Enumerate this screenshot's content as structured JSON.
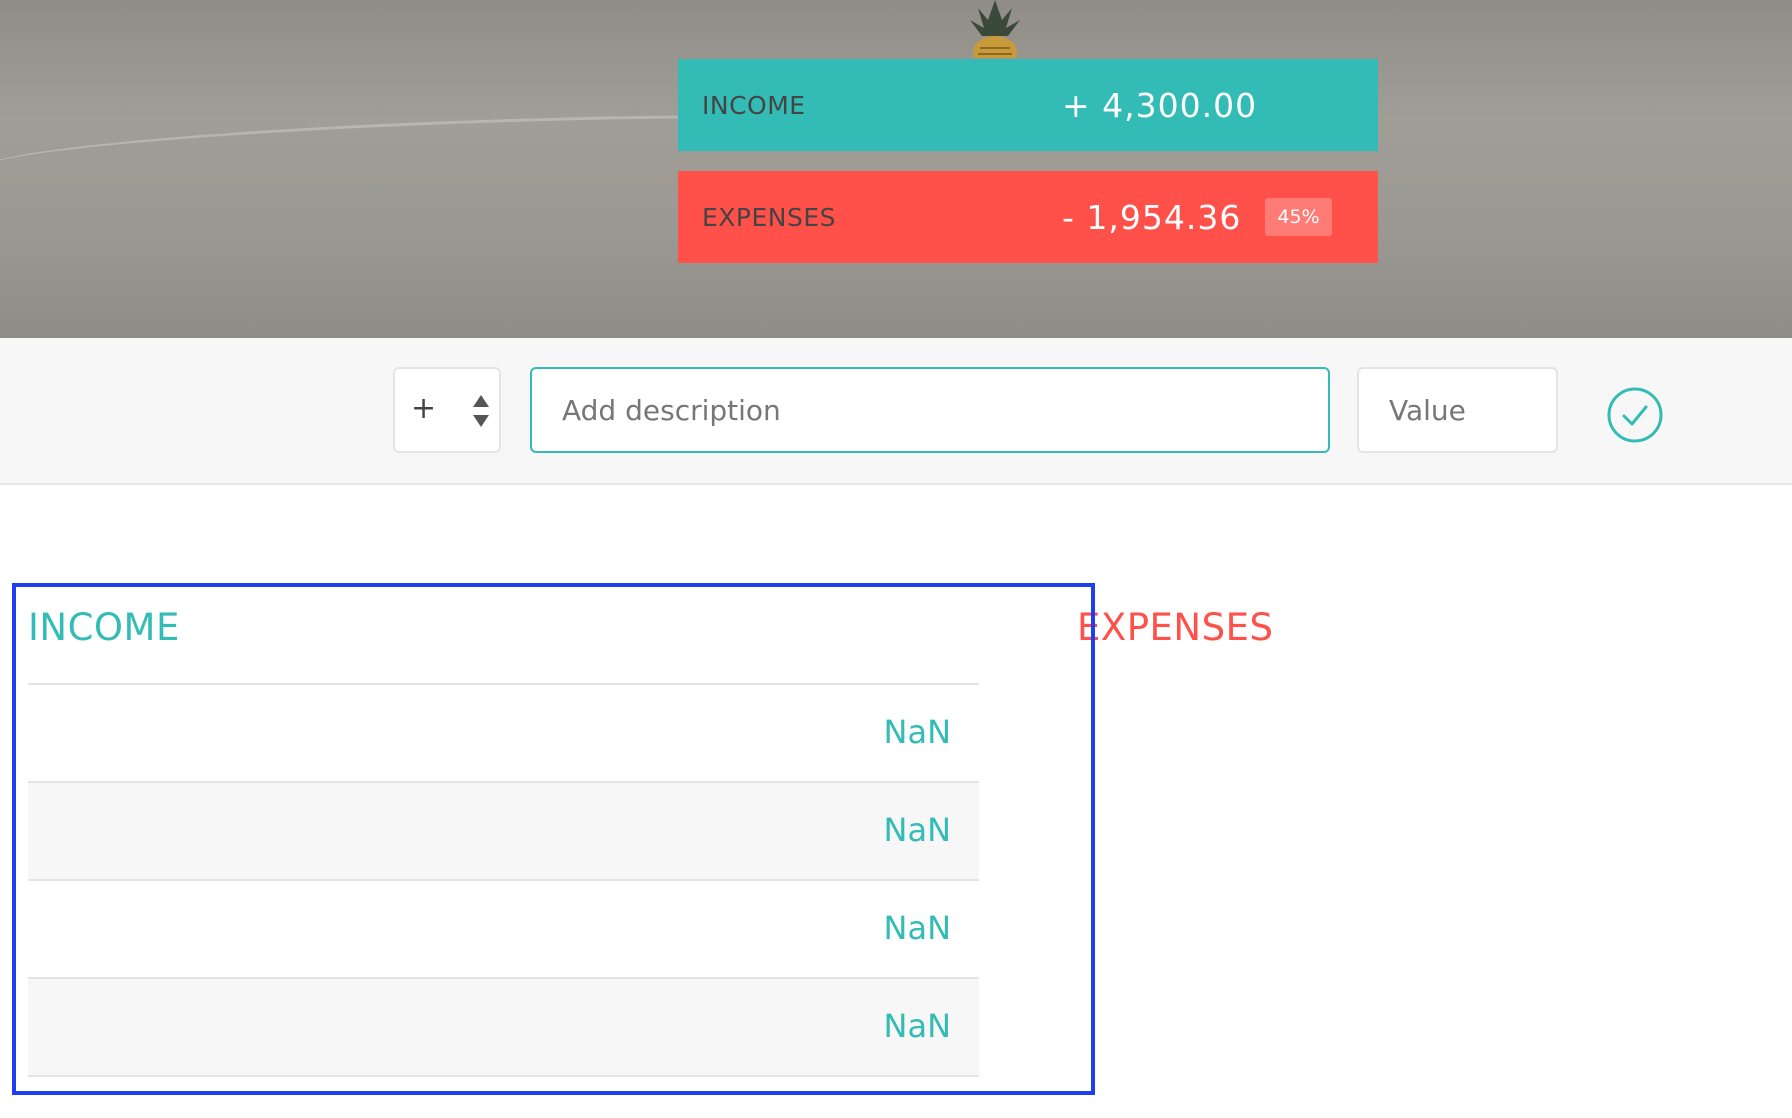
{
  "summary": {
    "income": {
      "label": "INCOME",
      "value": "+ 4,300.00"
    },
    "expenses": {
      "label": "EXPENSES",
      "value": "- 1,954.36",
      "percentage": "45%"
    }
  },
  "add_bar": {
    "type_select": {
      "selected": "+"
    },
    "description": {
      "placeholder": "Add description",
      "value": ""
    },
    "value_field": {
      "placeholder": "Value",
      "value": ""
    }
  },
  "lists": {
    "income": {
      "title": "INCOME",
      "items": [
        {
          "value": "NaN"
        },
        {
          "value": "NaN"
        },
        {
          "value": "NaN"
        },
        {
          "value": "NaN"
        }
      ]
    },
    "expenses": {
      "title": "EXPENSES"
    }
  },
  "colors": {
    "income": "#33bcb5",
    "expenses": "#ff5049",
    "highlight": "#1e3ff0"
  },
  "icons": {
    "type_arrows": "up-down-arrows-icon",
    "add": "check-circle-icon"
  }
}
